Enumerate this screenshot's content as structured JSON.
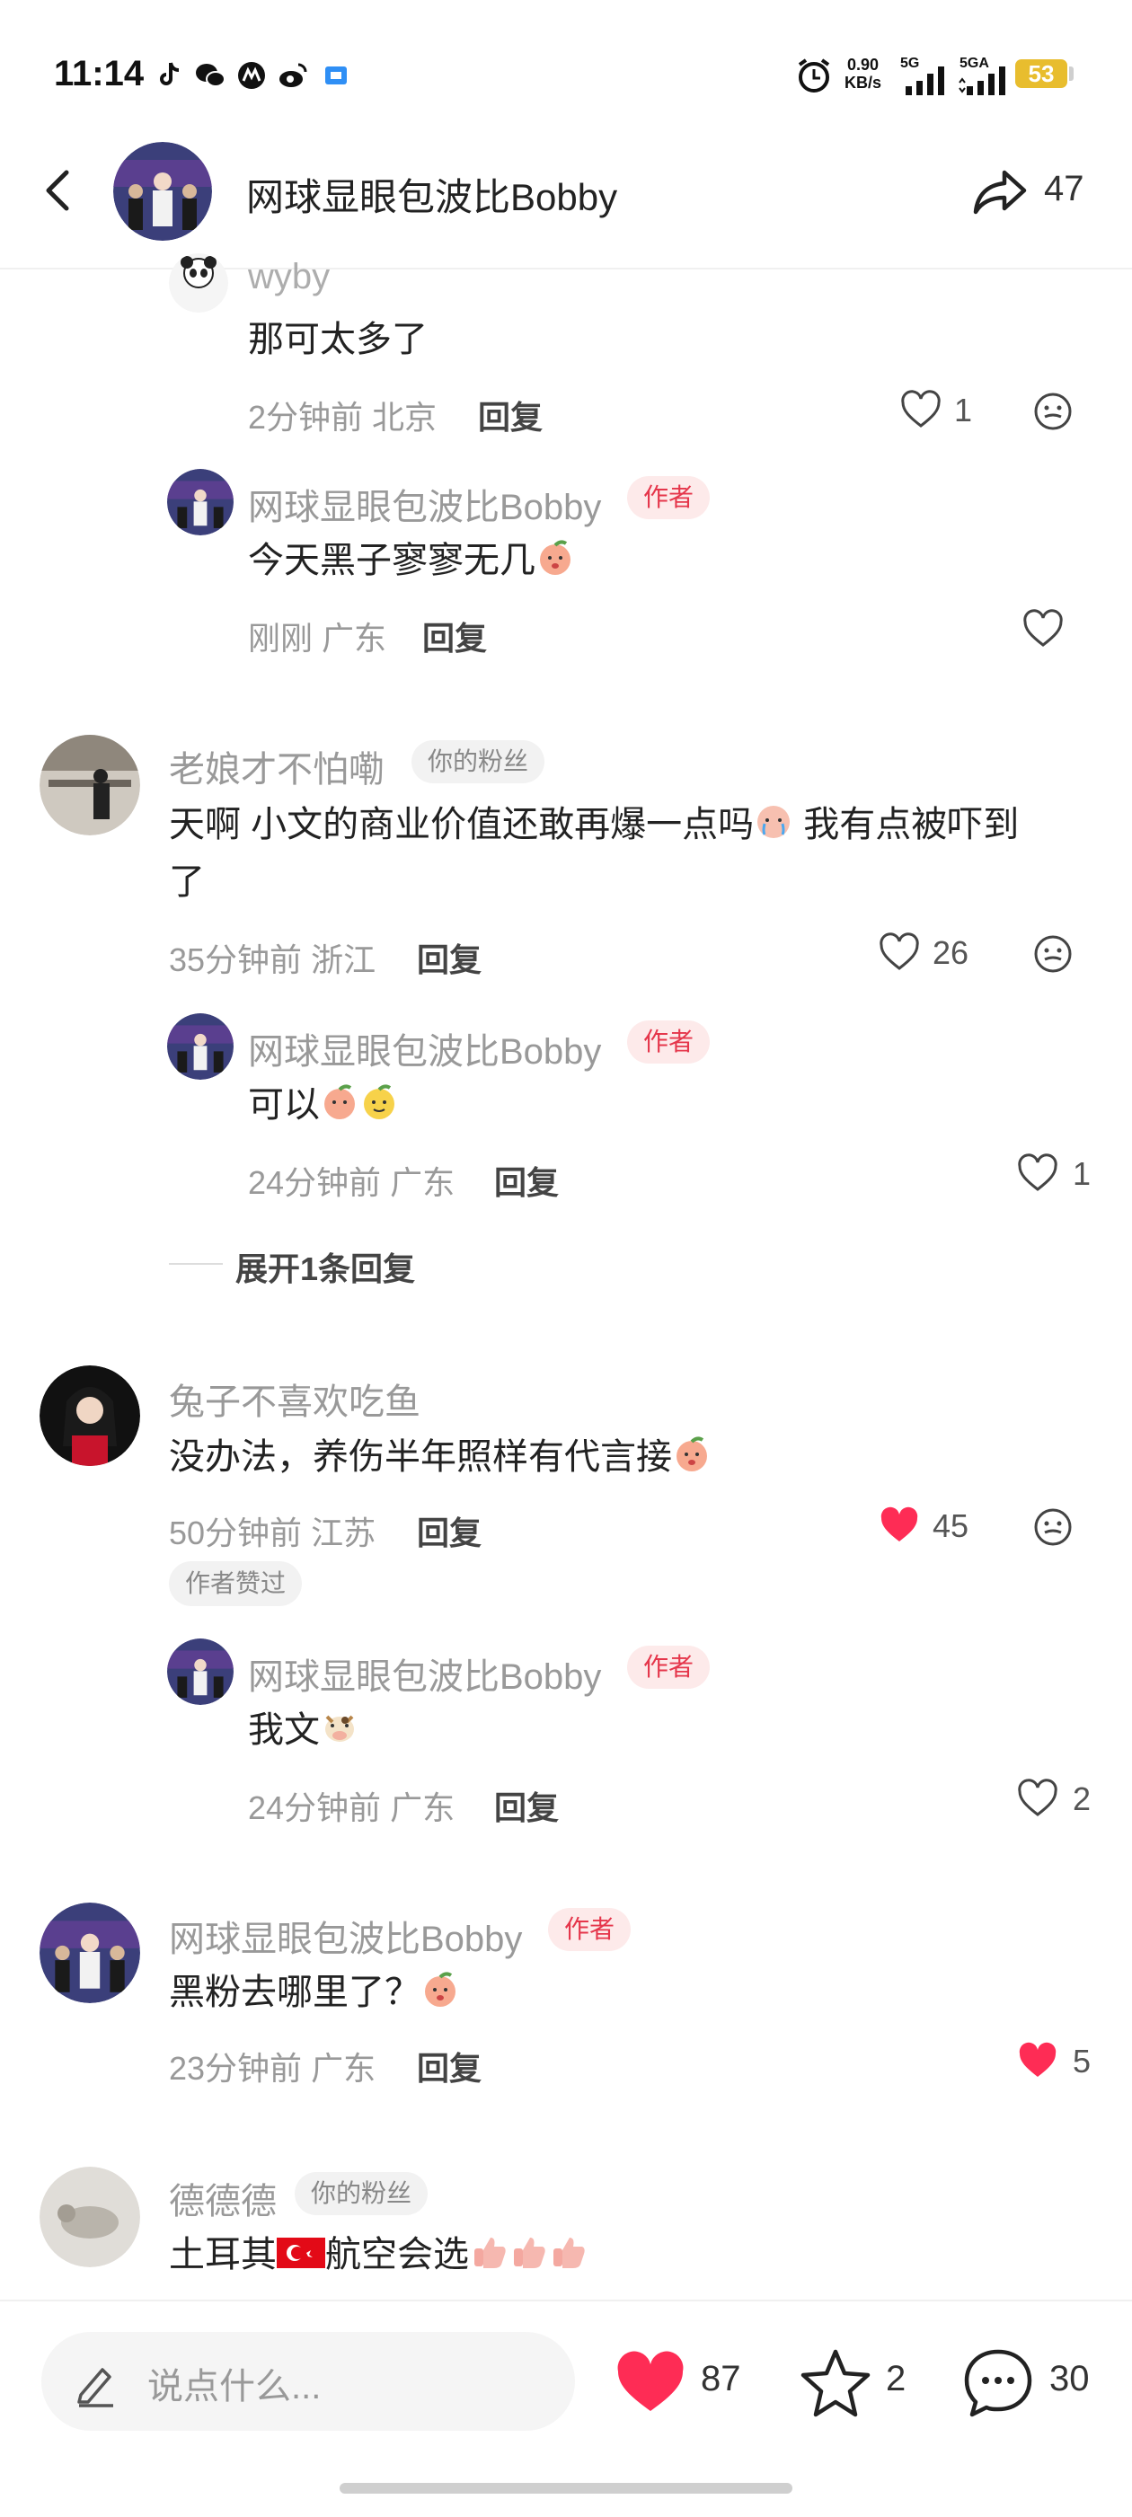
{
  "status_bar": {
    "time": "11:14",
    "net_speed_value": "0.90",
    "net_speed_unit": "KB/s",
    "signal1_label": "5G",
    "signal2_label": "5GA",
    "battery": "53",
    "app_icons": [
      "tiktok-icon",
      "wechat-icon",
      "app-icon",
      "weibo-icon",
      "app-icon-blue"
    ]
  },
  "header": {
    "title": "网球显眼包波比Bobby",
    "share_count": "47"
  },
  "comments": [
    {
      "username": "wyby",
      "text": "那可太多了",
      "time": "2分钟前",
      "location": "北京",
      "reply_label": "回复",
      "like_count": "1"
    },
    {
      "username": "网球显眼包波比Bobby",
      "badge": "作者",
      "text": "今天黑子寥寥无几",
      "time": "刚刚",
      "location": "广东",
      "reply_label": "回复"
    },
    {
      "username": "老娘才不怕嘞",
      "badge": "你的粉丝",
      "text_line1": "天啊 小文的商业价值还敢再爆一点吗",
      "text_line1b": "我有点被吓到",
      "text_line2": "了",
      "time": "35分钟前",
      "location": "浙江",
      "reply_label": "回复",
      "like_count": "26"
    },
    {
      "username": "网球显眼包波比Bobby",
      "badge": "作者",
      "text": "可以",
      "time": "24分钟前",
      "location": "广东",
      "reply_label": "回复",
      "like_count": "1"
    },
    {
      "expand_label": "展开1条回复"
    },
    {
      "username": "兔子不喜欢吃鱼",
      "text": "没办法，养伤半年照样有代言接",
      "time": "50分钟前",
      "location": "江苏",
      "reply_label": "回复",
      "like_count": "45",
      "liked_badge": "作者赞过"
    },
    {
      "username": "网球显眼包波比Bobby",
      "badge": "作者",
      "text": "我文",
      "time": "24分钟前",
      "location": "广东",
      "reply_label": "回复",
      "like_count": "2"
    },
    {
      "username": "网球显眼包波比Bobby",
      "badge": "作者",
      "text": "黑粉去哪里了？",
      "time": "23分钟前",
      "location": "广东",
      "reply_label": "回复",
      "like_count": "5"
    },
    {
      "username": "德德德",
      "badge": "你的粉丝",
      "text": "土耳其",
      "text_b": "航空会选"
    }
  ],
  "bottom_bar": {
    "placeholder": "说点什么...",
    "like_count": "87",
    "star_count": "2",
    "comment_count": "30"
  },
  "colors": {
    "like_red": "#fe2c55",
    "author_badge_bg": "#fdeaea",
    "author_badge_text": "#e5364b",
    "battery": "#e8bd2e"
  }
}
